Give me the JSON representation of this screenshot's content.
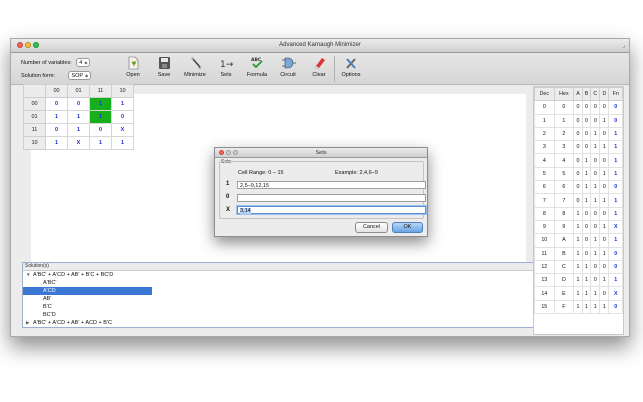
{
  "window": {
    "title": "Advanced Karnaugh Minimizer",
    "resize_glyph": "⌟"
  },
  "toolbar": {
    "num_vars_label": "Number of variables:",
    "num_vars_value": "4",
    "solution_form_label": "Solution form:",
    "solution_form_value": "SOP",
    "buttons": [
      {
        "label": "Open",
        "icon": "open-icon"
      },
      {
        "label": "Save",
        "icon": "save-icon"
      },
      {
        "label": "Minimize",
        "icon": "minimize-icon"
      },
      {
        "label": "Sets",
        "icon": "sets-icon"
      },
      {
        "label": "Formula",
        "icon": "formula-icon"
      },
      {
        "label": "Circuit",
        "icon": "circuit-icon"
      },
      {
        "label": "Clear",
        "icon": "clear-icon"
      },
      {
        "label": "Options",
        "icon": "options-icon"
      }
    ],
    "sets_icon_text": "1→9",
    "formula_icon_text": "ABC"
  },
  "kmap": {
    "col_headers": [
      "00",
      "01",
      "11",
      "10"
    ],
    "rows": [
      {
        "header": "00",
        "cells": [
          "0",
          "0",
          "1",
          "1"
        ]
      },
      {
        "header": "01",
        "cells": [
          "1",
          "1",
          "1",
          "0"
        ]
      },
      {
        "header": "11",
        "cells": [
          "0",
          "1",
          "0",
          "X"
        ]
      },
      {
        "header": "10",
        "cells": [
          "1",
          "X",
          "1",
          "1"
        ]
      }
    ],
    "highlight_color": "#17b01c"
  },
  "solutions": {
    "header": "Solution(s)",
    "rows": [
      {
        "text": "A'BC' + A'CD + AB' + B'C + BC'D",
        "toggle": "▼"
      },
      {
        "text": "A'BC'"
      },
      {
        "text": "A'CD"
      },
      {
        "text": "AB'"
      },
      {
        "text": "B'C"
      },
      {
        "text": "BC'D"
      },
      {
        "text": "A'BC' + A'CD + AB' + ACD + B'C",
        "toggle": "▶"
      }
    ]
  },
  "truth_table": {
    "headers": [
      "Dec",
      "Hex",
      "A",
      "B",
      "C",
      "D",
      "Fn"
    ],
    "rows": [
      [
        "0",
        "0",
        "0",
        "0",
        "0",
        "0",
        "0"
      ],
      [
        "1",
        "1",
        "0",
        "0",
        "0",
        "1",
        "0"
      ],
      [
        "2",
        "2",
        "0",
        "0",
        "1",
        "0",
        "1"
      ],
      [
        "3",
        "3",
        "0",
        "0",
        "1",
        "1",
        "1"
      ],
      [
        "4",
        "4",
        "0",
        "1",
        "0",
        "0",
        "1"
      ],
      [
        "5",
        "5",
        "0",
        "1",
        "0",
        "1",
        "1"
      ],
      [
        "6",
        "6",
        "0",
        "1",
        "1",
        "0",
        "0"
      ],
      [
        "7",
        "7",
        "0",
        "1",
        "1",
        "1",
        "1"
      ],
      [
        "8",
        "8",
        "1",
        "0",
        "0",
        "0",
        "1"
      ],
      [
        "9",
        "9",
        "1",
        "0",
        "0",
        "1",
        "X"
      ],
      [
        "10",
        "A",
        "1",
        "0",
        "1",
        "0",
        "1"
      ],
      [
        "11",
        "B",
        "1",
        "0",
        "1",
        "1",
        "0"
      ],
      [
        "12",
        "C",
        "1",
        "1",
        "0",
        "0",
        "0"
      ],
      [
        "13",
        "D",
        "1",
        "1",
        "0",
        "1",
        "1"
      ],
      [
        "14",
        "E",
        "1",
        "1",
        "1",
        "0",
        "X"
      ],
      [
        "15",
        "F",
        "1",
        "1",
        "1",
        "1",
        "0"
      ]
    ]
  },
  "sets_dialog": {
    "title": "Sets",
    "group_label": "Sets",
    "cell_range": "Cell Range: 0 – 15",
    "example": "Example: 2,4,6–9",
    "rows": [
      {
        "label": "1",
        "value": "2,5–9,12,15"
      },
      {
        "label": "0",
        "value": ""
      },
      {
        "label": "X",
        "value": "3,14"
      }
    ],
    "cancel_label": "Cancel",
    "ok_label": "OK"
  },
  "colors": {
    "selection": "#3a78d4",
    "accent_blue": "#1f2fd0"
  }
}
